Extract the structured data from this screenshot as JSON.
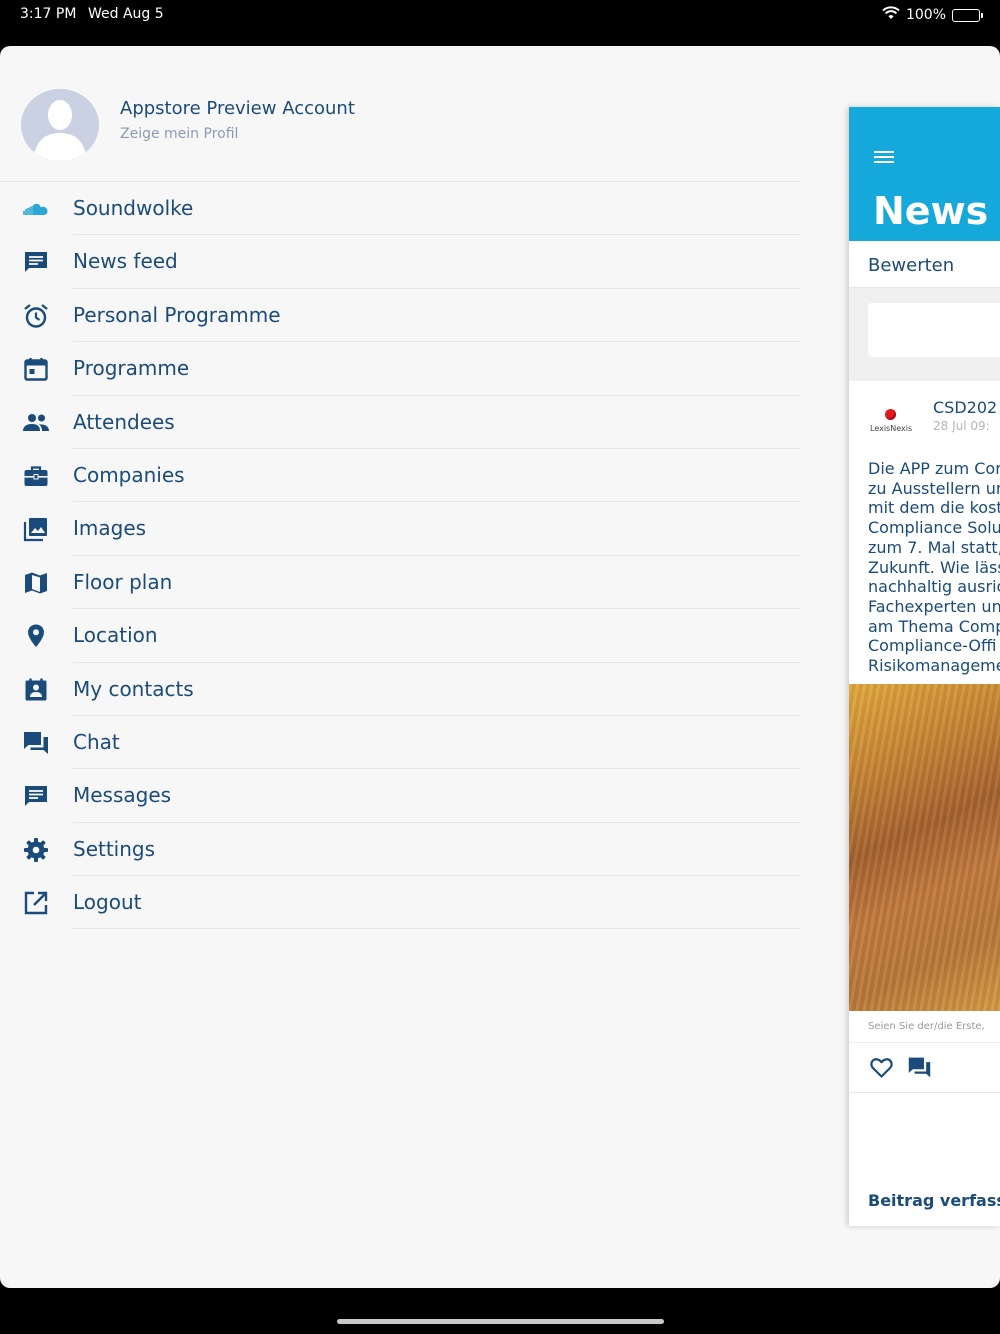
{
  "status_bar": {
    "time": "3:17 PM",
    "date": "Wed Aug 5",
    "battery": "100%",
    "battery_level": 1.0
  },
  "profile": {
    "name": "Appstore Preview Account",
    "subtitle": "Zeige mein Profil"
  },
  "menu": [
    {
      "label": "Soundwolke",
      "icon": "cloud-icon"
    },
    {
      "label": "News feed",
      "icon": "message-icon"
    },
    {
      "label": "Personal Programme",
      "icon": "alarm-icon"
    },
    {
      "label": "Programme",
      "icon": "calendar-icon"
    },
    {
      "label": "Attendees",
      "icon": "people-icon"
    },
    {
      "label": "Companies",
      "icon": "briefcase-icon"
    },
    {
      "label": "Images",
      "icon": "images-icon"
    },
    {
      "label": "Floor plan",
      "icon": "map-icon"
    },
    {
      "label": "Location",
      "icon": "location-pin-icon"
    },
    {
      "label": "My contacts",
      "icon": "contact-card-icon"
    },
    {
      "label": "Chat",
      "icon": "chat-icon"
    },
    {
      "label": "Messages",
      "icon": "message-icon"
    },
    {
      "label": "Settings",
      "icon": "gear-icon"
    },
    {
      "label": "Logout",
      "icon": "external-link-icon"
    }
  ],
  "newsfeed_panel": {
    "title": "News f",
    "tab": "Bewerten",
    "post": {
      "logo_text": "LexisNexis",
      "author": "CSD202",
      "date": "28 Jul 09:",
      "body_lines": [
        "Die APP zum Cor",
        "zu Ausstellern un",
        "mit dem die kost",
        "Compliance Solu",
        "zum 7. Mal statt,",
        "Zukunft. Wie läss",
        "nachhaltig ausric",
        "Fachexperten un",
        "am Thema Comp",
        "Compliance-Offi",
        "Risikomanageme"
      ],
      "hint": "Seien Sie der/die Erste,"
    },
    "compose": "Beitrag verfasse"
  },
  "colors": {
    "accent": "#15a8db",
    "text": "#1a4b7a",
    "subtext": "#8a9bb0",
    "background": "#f7f7f7"
  }
}
